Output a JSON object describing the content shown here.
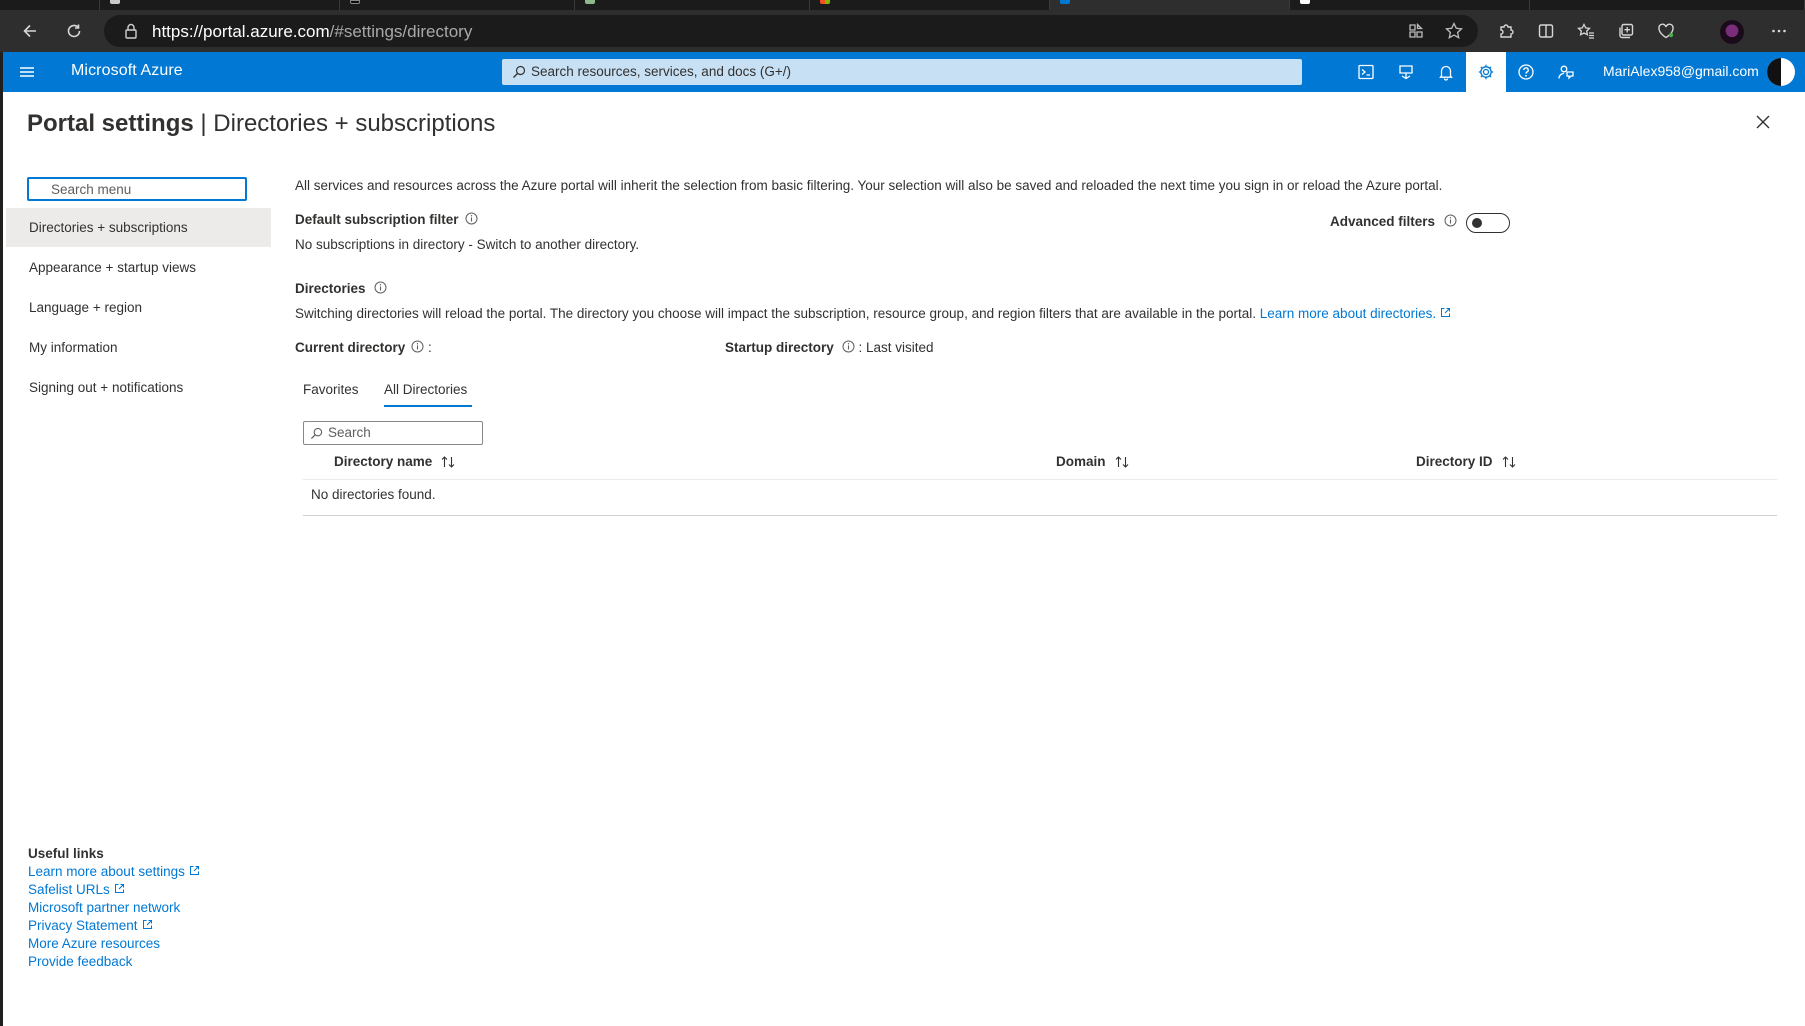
{
  "browser": {
    "url_host": "https://portal.azure.com",
    "url_rest": "/#settings/directory"
  },
  "header": {
    "brand": "Microsoft Azure",
    "search_placeholder": "Search resources, services, and docs (G+/)",
    "account": "MariAlex958@gmail.com"
  },
  "page": {
    "title_bold": "Portal settings",
    "title_sep": " | ",
    "title_rest": "Directories + subscriptions"
  },
  "nav": {
    "search_placeholder": "Search menu",
    "items": [
      {
        "label": "Directories + subscriptions",
        "selected": true
      },
      {
        "label": "Appearance + startup views"
      },
      {
        "label": "Language + region"
      },
      {
        "label": "My information"
      },
      {
        "label": "Signing out + notifications"
      }
    ]
  },
  "useful_links": {
    "header": "Useful links",
    "links": [
      "Learn more about settings",
      "Safelist URLs",
      "Microsoft partner network",
      "Privacy Statement",
      "More Azure resources",
      "Provide feedback"
    ]
  },
  "content": {
    "intro": "All services and resources across the Azure portal will inherit the selection from basic filtering. Your selection will also be saved and reloaded the next time you sign in or reload the Azure portal.",
    "default_filter_label": "Default subscription filter",
    "default_filter_value": "No subscriptions in directory - Switch to another directory.",
    "advanced_filters_label": "Advanced filters",
    "advanced_filters_on": false,
    "directories_label": "Directories",
    "directories_desc": "Switching directories will reload the portal. The directory you choose will impact the subscription, resource group, and region filters that are available in the portal.",
    "directories_link": "Learn more about directories.",
    "current_directory_label": "Current directory",
    "current_directory_sep": " :",
    "startup_directory_label": "Startup directory",
    "startup_directory_value": " : Last visited",
    "tabs": [
      "Favorites",
      "All Directories"
    ],
    "active_tab": "All Directories",
    "grid_search_placeholder": "Search",
    "columns": [
      "Directory name",
      "Domain",
      "Directory ID"
    ],
    "empty_message": "No directories found."
  }
}
